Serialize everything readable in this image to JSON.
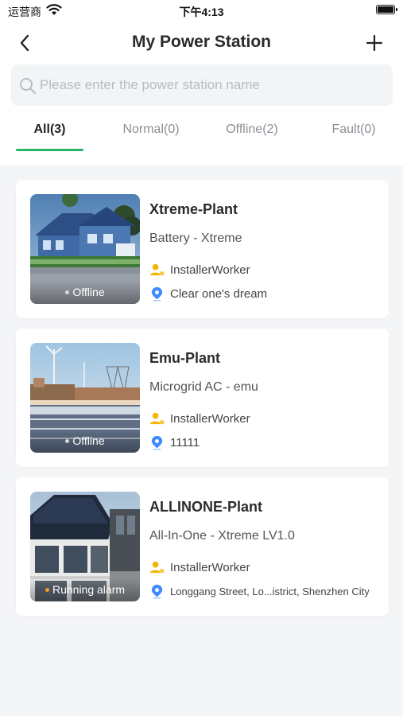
{
  "status_bar": {
    "carrier": "运营商",
    "time": "下午4:13"
  },
  "header": {
    "title": "My Power Station"
  },
  "search": {
    "placeholder": "Please enter the power station name",
    "value": ""
  },
  "tabs": [
    {
      "label": "All(3)",
      "active": true
    },
    {
      "label": "Normal(0)",
      "active": false
    },
    {
      "label": "Offline(2)",
      "active": false
    },
    {
      "label": "Fault(0)",
      "active": false
    }
  ],
  "stations": [
    {
      "name": "Xtreme-Plant",
      "type": "Battery - Xtreme",
      "owner": "InstallerWorker",
      "address": "Clear one's dream",
      "status": "Offline"
    },
    {
      "name": "Emu-Plant",
      "type": "Microgrid AC - emu",
      "owner": "InstallerWorker",
      "address": "11111",
      "status": "Offline"
    },
    {
      "name": "ALLINONE-Plant",
      "type": "All-In-One - Xtreme LV1.0",
      "owner": "InstallerWorker",
      "address": "Longgang Street, Lo...istrict, Shenzhen City",
      "status": "Running alarm"
    }
  ],
  "colors": {
    "accent": "#27b36a",
    "owner_icon": "#f5b400",
    "location_icon": "#3d8bff",
    "alarm_dot": "#f39a2b"
  },
  "icons": {
    "back": "chevron-left-icon",
    "add": "plus-icon",
    "search": "search-icon",
    "owner": "person-icon",
    "location": "location-pin-icon"
  }
}
